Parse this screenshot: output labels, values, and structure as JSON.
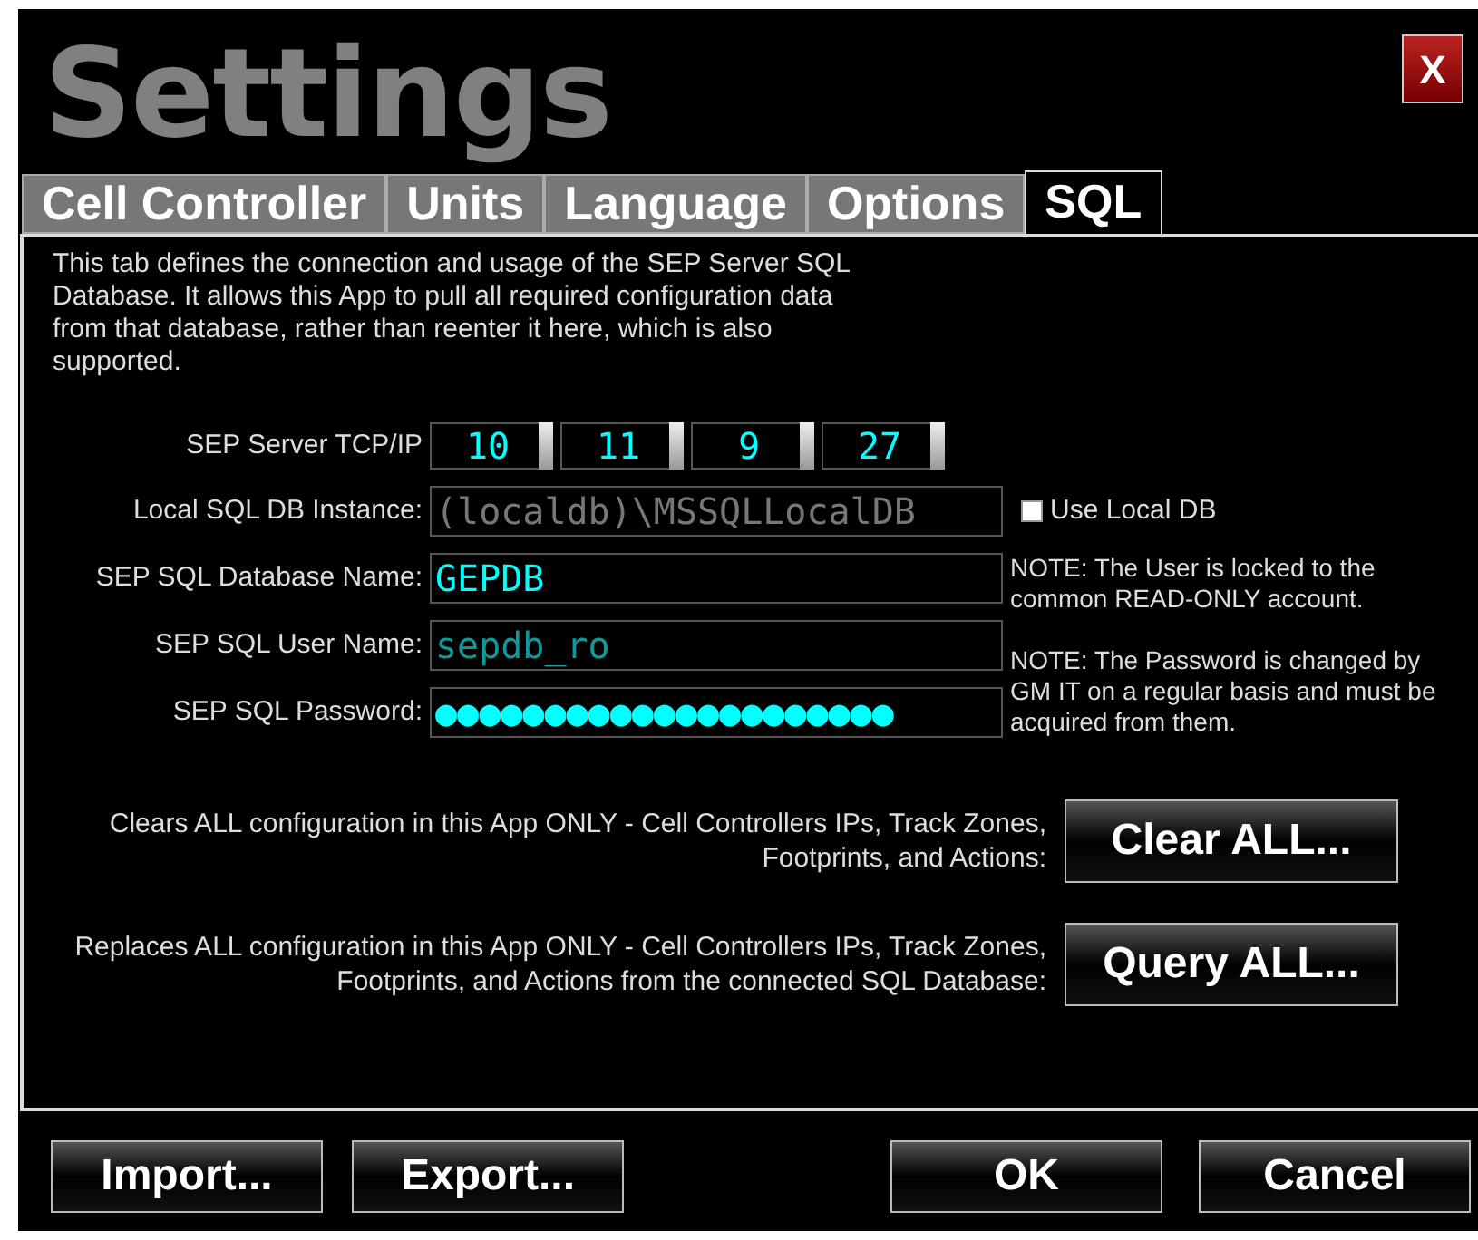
{
  "window": {
    "title": "Settings",
    "close": "X"
  },
  "tabs": [
    {
      "label": "Cell Controller",
      "selected": false
    },
    {
      "label": "Units",
      "selected": false
    },
    {
      "label": "Language",
      "selected": false
    },
    {
      "label": "Options",
      "selected": false
    },
    {
      "label": "SQL",
      "selected": true
    }
  ],
  "description": "This tab defines the connection and usage of the SEP Server SQL Database. It allows this App to pull all required configuration data from that database, rather than reenter it here, which is also supported.",
  "ip": {
    "label": "SEP Server TCP/IP",
    "octets": [
      "10",
      "11",
      "9",
      "27"
    ]
  },
  "local_instance": {
    "label": "Local SQL DB Instance:",
    "value": "(localdb)\\MSSQLLocalDB",
    "disabled": true,
    "checkbox": {
      "label": "Use Local DB",
      "checked": false
    }
  },
  "database_name": {
    "label": "SEP SQL Database Name:",
    "value": "GEPDB",
    "note": "NOTE: The User is locked to the common READ-ONLY account."
  },
  "user_name": {
    "label": "SEP SQL User Name:",
    "value": "sepdb_ro",
    "disabled": true
  },
  "password": {
    "label": "SEP SQL Password:",
    "value": "●●●●●●●●●●●●●●●●●●●●●",
    "note": "NOTE: The Password is changed by GM IT on a regular basis and must be acquired from them."
  },
  "actions": [
    {
      "text": "Clears ALL configuration in this App ONLY - Cell Controllers IPs, Track Zones, Footprints, and Actions:",
      "button": "Clear ALL..."
    },
    {
      "text": "Replaces ALL configuration in this App ONLY - Cell Controllers IPs, Track Zones, Footprints, and Actions from the connected SQL Database:",
      "button": "Query ALL..."
    }
  ],
  "footer_left": [
    "Import...",
    "Export..."
  ],
  "footer_right": [
    "OK",
    "Cancel"
  ]
}
